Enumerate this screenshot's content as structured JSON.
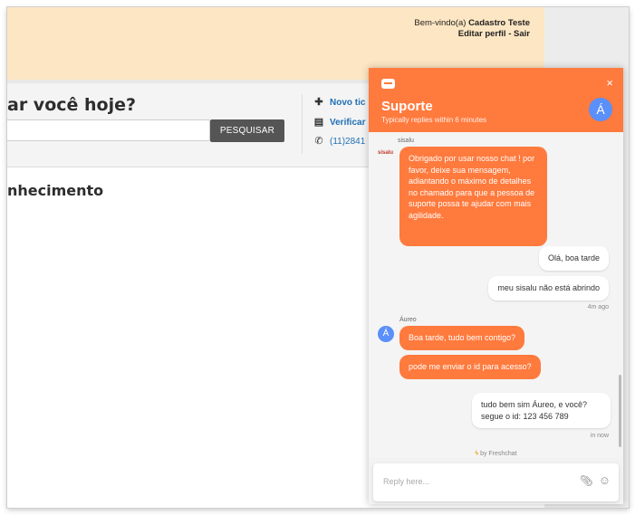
{
  "site": {
    "welcome_prefix": "Bem-vindo(a)",
    "user_name": "Cadastro Teste",
    "edit_profile": "Editar perfil",
    "separator": "-",
    "logout": "Sair",
    "heading": "ar você hoje?",
    "search_button": "PESQUISAR",
    "links": [
      {
        "icon": "plus-icon",
        "label": "Novo tic"
      },
      {
        "icon": "document-icon",
        "label": "Verificar"
      },
      {
        "icon": "phone-icon",
        "label": "(11)2841"
      }
    ],
    "knowledge_heading": "nhecimento"
  },
  "chat": {
    "title": "Suporte",
    "subtitle": "Typically replies within 6 minutes",
    "close": "×",
    "agent_initial": "Á",
    "first_sender": "sisalu",
    "first_sender_logo": "sisalu",
    "agent_name": "Áureo",
    "messages": [
      {
        "from": "agent",
        "text": "Obrigado por usar nosso chat ! por favor, deixe sua mensagem, adiantando o máximo de detalhes no chamado para que a pessoa de suporte possa te ajudar com mais agilidade."
      },
      {
        "from": "user",
        "text": "Olá, boa tarde"
      },
      {
        "from": "user",
        "text": "meu sisalu não está abrindo"
      },
      {
        "from": "agent",
        "text": "Boa tarde, tudo bem contigo?"
      },
      {
        "from": "agent",
        "text": "pode me enviar o id para acesso?"
      },
      {
        "from": "user",
        "text": "tudo bem sim Áureo, e você? segue o id: 123 456 789"
      }
    ],
    "time_1": "4m ago",
    "time_2": "in now",
    "powered_by": "by Freshchat",
    "reply_placeholder": "Reply here..."
  },
  "colors": {
    "accent": "#ff7a3d",
    "header_bg": "#fde6c3",
    "avatar": "#5b8ff9"
  }
}
